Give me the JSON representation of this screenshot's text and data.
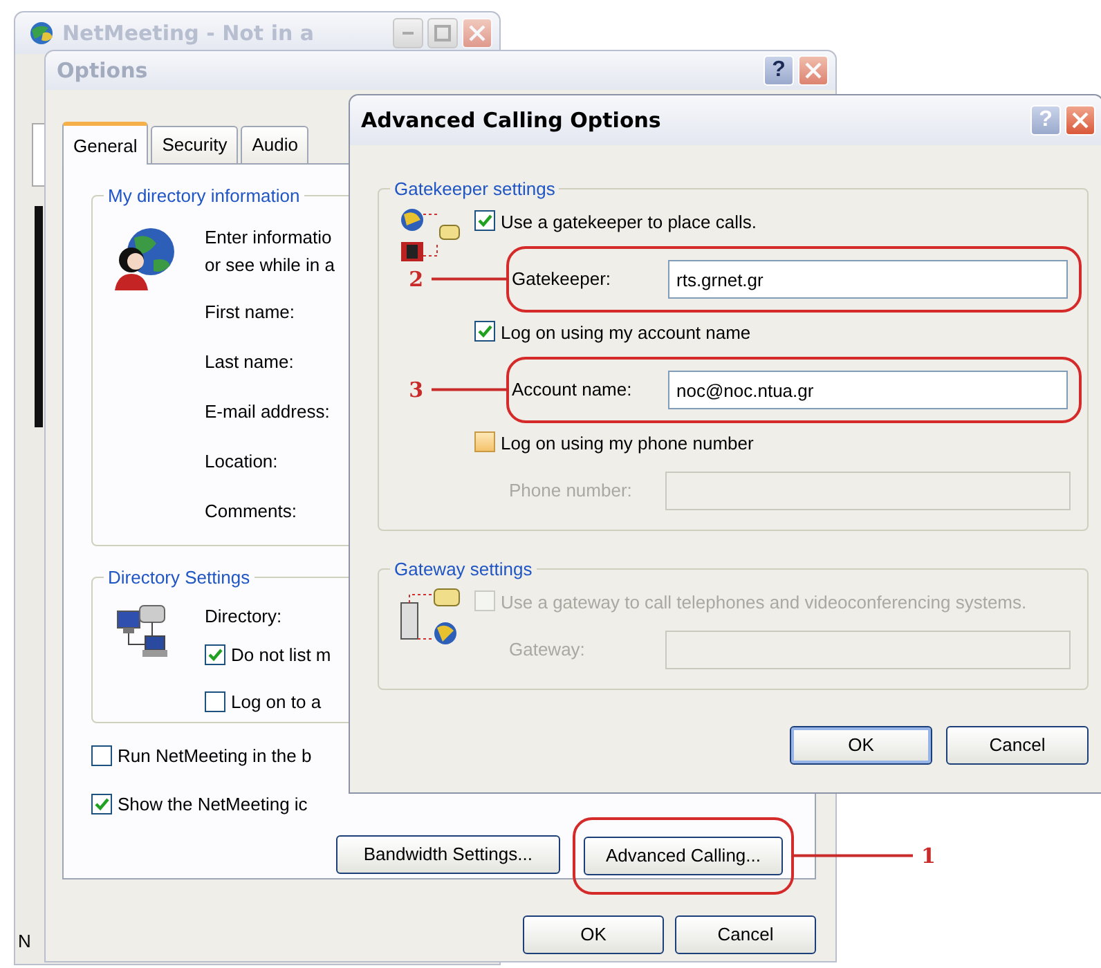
{
  "netmeeting_window": {
    "title": "NetMeeting - Not in a",
    "status_text": "N"
  },
  "options_dialog": {
    "title": "Options",
    "help_button": "?",
    "tabs": [
      {
        "label": "General",
        "selected": true
      },
      {
        "label": "Security",
        "selected": false
      },
      {
        "label": "Audio",
        "selected": false
      }
    ],
    "directory_info": {
      "title": "My directory information",
      "intro": [
        "Enter informatio",
        "or see while in a"
      ],
      "fields": [
        "First name:",
        "Last name:",
        "E-mail address:",
        "Location:",
        "Comments:"
      ]
    },
    "directory_settings": {
      "title": "Directory Settings",
      "directory_label": "Directory:",
      "checkboxes": [
        {
          "label": "Do not list m",
          "checked": true
        },
        {
          "label": "Log on to a",
          "checked": false
        }
      ]
    },
    "checkboxes": [
      {
        "label": "Run NetMeeting in the b",
        "checked": false
      },
      {
        "label": "Show the NetMeeting ic",
        "checked": true
      }
    ],
    "buttons": [
      {
        "label": "Bandwidth Settings..."
      },
      {
        "label": "Advanced Calling...",
        "annotation": "1"
      }
    ],
    "footer_buttons": [
      {
        "label": "OK"
      },
      {
        "label": "Cancel"
      }
    ]
  },
  "advanced_dialog": {
    "title": "Advanced Calling Options",
    "help_button": "?",
    "groups": [
      {
        "title": "Gatekeeper settings",
        "rows": [
          {
            "kind": "checkbox",
            "label": "Use a gatekeeper to place calls.",
            "checked": true,
            "disabled": false
          },
          {
            "kind": "field",
            "label": "Gatekeeper:",
            "value": "rts.grnet.gr",
            "disabled": false,
            "annotation": "2"
          },
          {
            "kind": "checkbox",
            "label": "Log on using my account name",
            "checked": true,
            "disabled": false
          },
          {
            "kind": "field",
            "label": "Account name:",
            "value": "noc@noc.ntua.gr",
            "disabled": false,
            "annotation": "3"
          },
          {
            "kind": "checkbox",
            "label": "Log on using my phone number",
            "checked": false,
            "hover": true,
            "disabled": false
          },
          {
            "kind": "field",
            "label": "Phone number:",
            "disabled": true
          }
        ]
      },
      {
        "title": "Gateway settings",
        "rows": [
          {
            "kind": "checkbox",
            "label": "Use a gateway to call telephones and videoconferencing systems.",
            "checked": false,
            "disabled": true
          },
          {
            "kind": "field",
            "label": "Gateway:",
            "disabled": true
          }
        ]
      }
    ],
    "buttons": [
      {
        "label": "OK",
        "default": true
      },
      {
        "label": "Cancel",
        "default": false
      }
    ]
  }
}
